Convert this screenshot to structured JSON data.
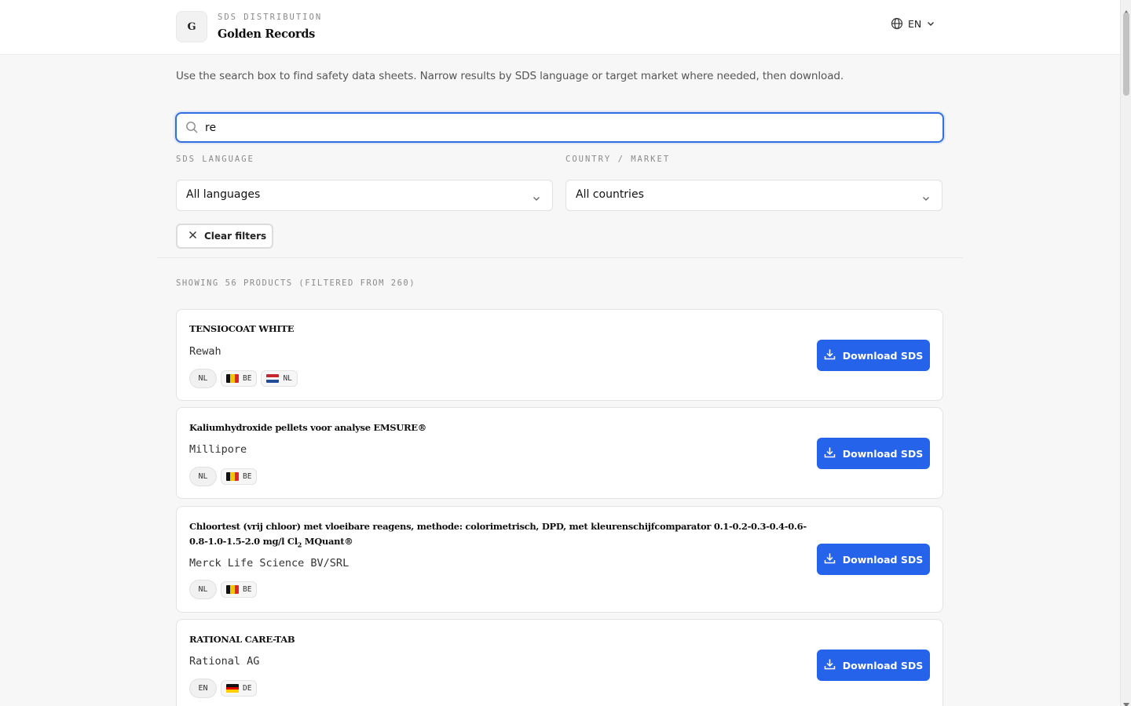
{
  "header": {
    "logo_letter": "G",
    "eyebrow": "SDS DISTRIBUTION",
    "brand_name": "Golden Records",
    "language_code": "EN"
  },
  "intro_text": "Use the search box to find safety data sheets. Narrow results by SDS language or target market where needed, then download.",
  "search": {
    "value": "re"
  },
  "filters": {
    "language_label": "SDS LANGUAGE",
    "language_value": "All languages",
    "country_label": "COUNTRY / MARKET",
    "country_value": "All countries",
    "clear_label": "Clear filters"
  },
  "results_summary": "SHOWING 56 PRODUCTS (FILTERED FROM 260)",
  "download_label": "Download SDS",
  "products": [
    {
      "title": "TENSIOCOAT WHITE",
      "maker": "Rewah",
      "language": "NL",
      "countries": [
        {
          "code": "BE",
          "flag": "be"
        },
        {
          "code": "NL",
          "flag": "nl"
        }
      ]
    },
    {
      "title": "Kaliumhydroxide pellets voor analyse EMSURE®",
      "maker": "Millipore",
      "language": "NL",
      "countries": [
        {
          "code": "BE",
          "flag": "be"
        }
      ]
    },
    {
      "title_line1": "Chloortest (vrij chloor) met vloeibare reagens, methode: colorimetrisch, DPD, met kleurenschijfcomparator 0.1-0.2-0.3-0.4-0.6-0.8-1.0-1.5-2.0",
      "title_line2_pre": "mg/l Cl",
      "title_line2_sub": "2",
      "title_line2_post": " MQuant®",
      "maker": "Merck Life Science BV/SRL",
      "language": "NL",
      "countries": [
        {
          "code": "BE",
          "flag": "be"
        }
      ]
    },
    {
      "title": "RATIONAL CARE-TAB",
      "maker": "Rational AG",
      "language": "EN",
      "countries": [
        {
          "code": "DE",
          "flag": "de"
        }
      ]
    }
  ],
  "colors": {
    "accent": "#2563eb",
    "focus_ring": "#2f6fe0",
    "background": "#f7f7f7"
  },
  "icons": [
    "globe-icon",
    "chevron-down-icon",
    "search-icon",
    "close-icon",
    "download-icon"
  ]
}
